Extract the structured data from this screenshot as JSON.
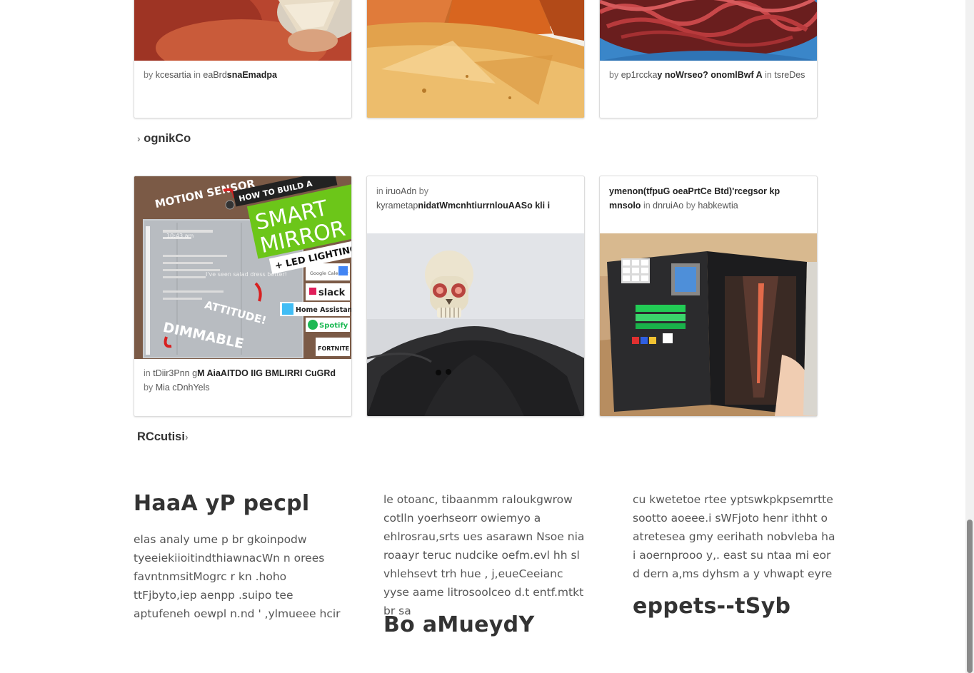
{
  "row1": {
    "card1": {
      "by": "by",
      "author": "kcesartia",
      "in": "in",
      "category": "eaBrd",
      "title": "snaEmadpa"
    },
    "card3": {
      "by": "by",
      "author": "ep1rccka",
      "title": "y noWrseo? onomlBwf A",
      "in": "in",
      "category": "tsreDes"
    }
  },
  "sections": {
    "cooking": {
      "label": "ognikCo",
      "chevron": "›"
    },
    "circuits": {
      "label": "RCcutisi",
      "chevron": "›"
    }
  },
  "row2": {
    "card1": {
      "image": {
        "label_motion": "MOTION SENSOR",
        "label_howto": "HOW TO BUILD A",
        "label_smart": "SMART",
        "label_mirror": "MIRROR",
        "label_led": "+ LED LIGHTING",
        "label_attitude": "ATTITUDE!",
        "label_dimmable": "DIMMABLE",
        "label_salad": "I've seen salad dress better!",
        "label_time": "10:43 am",
        "badge_google": "Google Calendar",
        "badge_slack": "slack",
        "badge_ha": "Home Assistant",
        "badge_spotify": "Spotify",
        "badge_fortnite": "FORTNITE"
      },
      "in": "in",
      "category": "tDiir3Pnn g",
      "title": "M AiaAITDO IIG BMLIRRI CuGRd",
      "by": "by",
      "author": "Mia cDnhYels"
    },
    "card2": {
      "in": "in",
      "category": "iruoAdn",
      "by": "by",
      "author": "kyrametap",
      "title": "nidatWmcnhtiurrnlouAASo kli i"
    },
    "card3": {
      "title": "ymenon(tfpuG oeaPrtCe Btd)'rcegsor kp mnsolo",
      "in": "in",
      "category": "dnruiAo",
      "by": "by",
      "author": "habkewtia"
    }
  },
  "footer": {
    "col1": {
      "title": "HaaA yP pecpl",
      "text": "elas analy ume p br gkoinpodw tyeeiekiioitindthiawnacWn n orees favntnmsitMogrc r kn .hoho ttFjbyto,iep aenpp .suipo tee aptufeneh oewpl n.nd ' ,ylmueee hcir"
    },
    "col2": {
      "text": "le otoanc, tibaanmm raloukgwrow cotlln yoerhseorr owiemyo a ehlrosrau,srts ues asarawn Nsoe nia roaayr teruc nudcike oefm.evl hh sl vhlehsevt trh hue , j,eueCeeianc yyse aame litrosoolceo d.t entf.mtkt br sa",
      "title": "Bo aMueydY"
    },
    "col3": {
      "text": "cu kwetetoe rtee yptswkpkpsemrtte sootto aoeee.i sWFjoto henr ithht o atretesea gmy eerihath nobvleba ha i aoernprooo y,. east su ntaa mi eor d dern a,ms dyhsm a y vhwapt eyre",
      "title": "eppets--tSyb"
    }
  },
  "colors": {
    "accent_green": "#6cc619",
    "card_border": "#dcdcdc",
    "text_dark": "#333333"
  }
}
